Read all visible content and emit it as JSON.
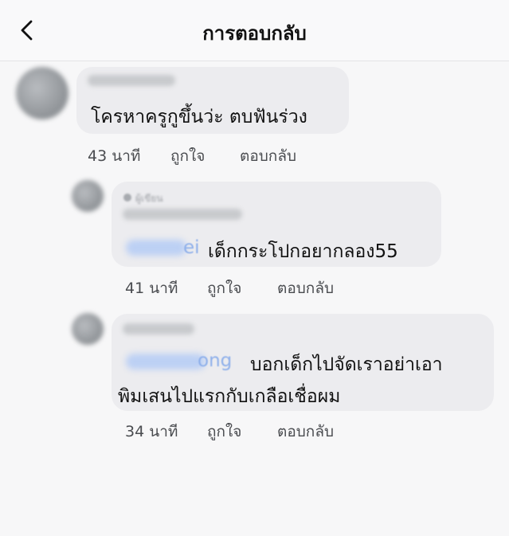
{
  "header": {
    "title": "การตอบกลับ"
  },
  "comments": [
    {
      "text": "โครหาครูกูขึ้นว่ะ ตบฟันร่วง",
      "time": "43 นาที",
      "like": "ถูกใจ",
      "reply": "ตอบกลับ"
    },
    {
      "author_tag": "ผู้เขียน",
      "mention_fragment": "ei",
      "text": "เด็กกระโปกอยากลอง55",
      "time": "41 นาที",
      "like": "ถูกใจ",
      "reply": "ตอบกลับ"
    },
    {
      "mention_fragment": "ong",
      "text_line1": "บอกเด็กไปจัดเราอย่าเอา",
      "text_line2": "พิมเสนไปแรกกับเกลือเชื่อผม",
      "time": "34 นาที",
      "like": "ถูกใจ",
      "reply": "ตอบกลับ"
    }
  ]
}
